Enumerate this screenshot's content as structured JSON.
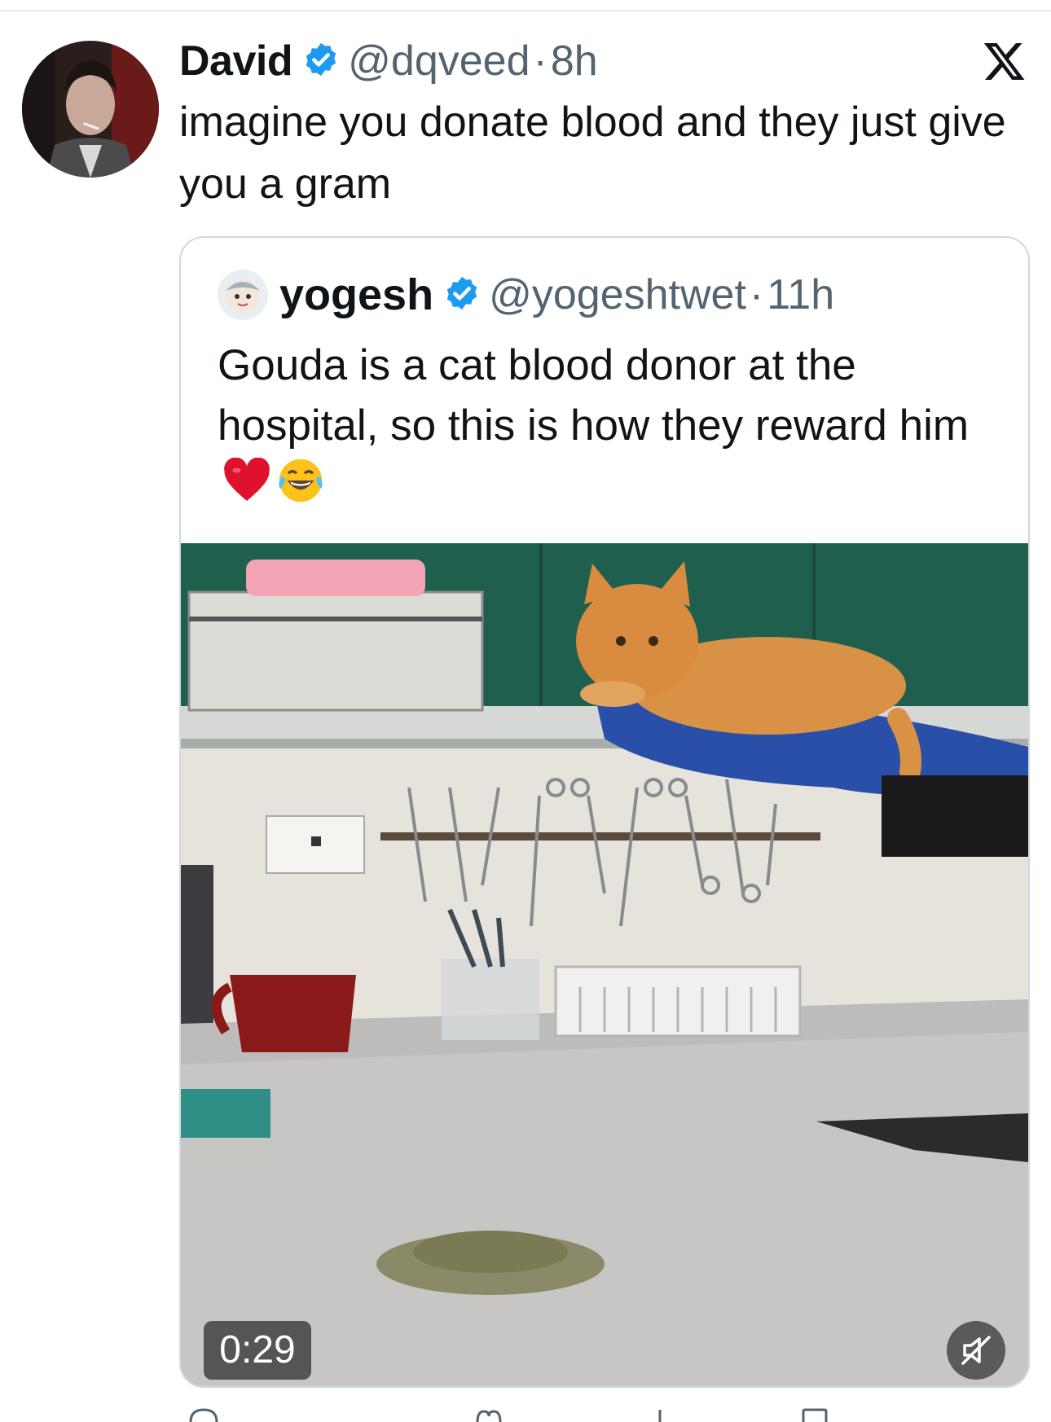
{
  "tweet": {
    "author_name": "David",
    "handle": "@dqveed",
    "separator": "·",
    "time": "8h",
    "text": "imagine you donate blood and they just give you a gram"
  },
  "quoted": {
    "author_name": "yogesh",
    "handle": "@yogeshtwet",
    "separator": "·",
    "time": "11h",
    "text": "Gouda is a cat blood donor at the hospital, so this is how they reward him"
  },
  "video": {
    "duration": "0:29",
    "muted": true
  },
  "icons": {
    "verified": "verified-badge-icon",
    "logo": "x-logo-icon",
    "mute": "speaker-muted-icon",
    "emoji_1": "red-heart",
    "emoji_2": "face-with-tears-of-joy"
  },
  "colors": {
    "verified": "#1d9bf0",
    "secondary_text": "#536471",
    "border": "#cfd9de"
  }
}
